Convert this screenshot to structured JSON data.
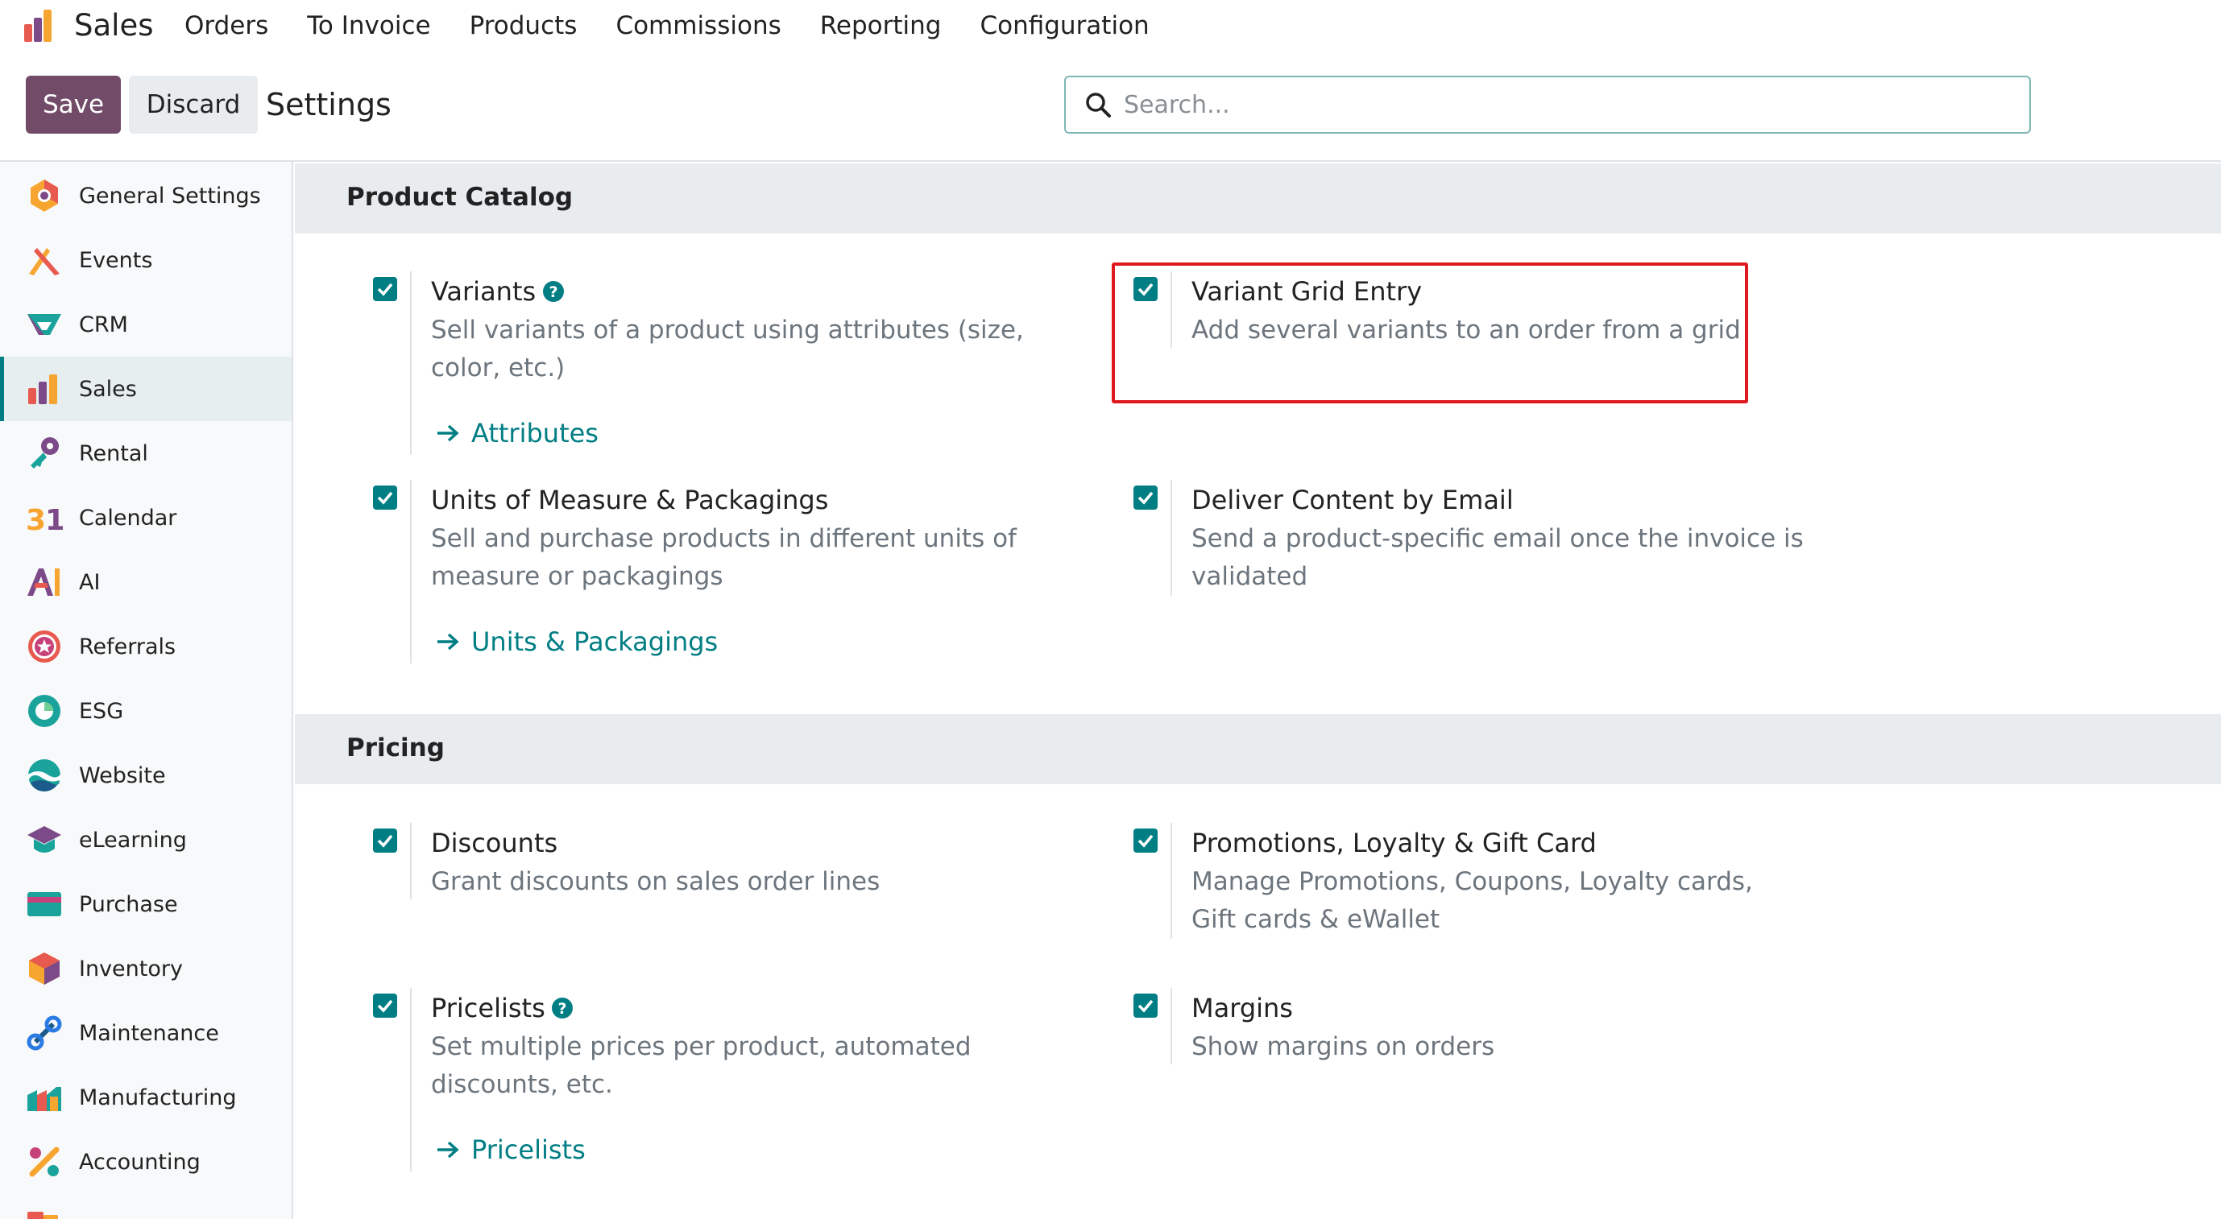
{
  "app": {
    "name": "Sales",
    "menu": [
      "Orders",
      "To Invoice",
      "Products",
      "Commissions",
      "Reporting",
      "Configuration"
    ]
  },
  "controls": {
    "save_label": "Save",
    "discard_label": "Discard",
    "title": "Settings",
    "search_placeholder": "Search..."
  },
  "sidebar": {
    "items": [
      {
        "label": "General Settings",
        "icon": "general-settings-icon"
      },
      {
        "label": "Events",
        "icon": "events-icon"
      },
      {
        "label": "CRM",
        "icon": "crm-icon"
      },
      {
        "label": "Sales",
        "icon": "sales-icon",
        "active": true
      },
      {
        "label": "Rental",
        "icon": "rental-icon"
      },
      {
        "label": "Calendar",
        "icon": "calendar-icon"
      },
      {
        "label": "AI",
        "icon": "ai-icon"
      },
      {
        "label": "Referrals",
        "icon": "referrals-icon"
      },
      {
        "label": "ESG",
        "icon": "esg-icon"
      },
      {
        "label": "Website",
        "icon": "website-icon"
      },
      {
        "label": "eLearning",
        "icon": "elearning-icon"
      },
      {
        "label": "Purchase",
        "icon": "purchase-icon"
      },
      {
        "label": "Inventory",
        "icon": "inventory-icon"
      },
      {
        "label": "Maintenance",
        "icon": "maintenance-icon"
      },
      {
        "label": "Manufacturing",
        "icon": "manufacturing-icon"
      },
      {
        "label": "Accounting",
        "icon": "accounting-icon"
      }
    ]
  },
  "sections": {
    "catalog": {
      "title": "Product Catalog",
      "variants": {
        "title": "Variants",
        "desc": "Sell variants of a product using attributes (size, color, etc.)",
        "link": "Attributes",
        "checked": true
      },
      "grid": {
        "title": "Variant Grid Entry",
        "desc": "Add several variants to an order from a grid",
        "checked": true
      },
      "uom": {
        "title": "Units of Measure & Packagings",
        "desc": "Sell and purchase products in different units of measure or packagings",
        "link": "Units & Packagings",
        "checked": true
      },
      "email": {
        "title": "Deliver Content by Email",
        "desc": "Send a product-specific email once the invoice is validated",
        "checked": true
      }
    },
    "pricing": {
      "title": "Pricing",
      "discounts": {
        "title": "Discounts",
        "desc": "Grant discounts on sales order lines",
        "checked": true
      },
      "promotions": {
        "title": "Promotions, Loyalty & Gift Card",
        "desc": "Manage Promotions, Coupons, Loyalty cards, Gift cards & eWallet",
        "checked": true
      },
      "pricelists": {
        "title": "Pricelists",
        "desc": "Set multiple prices per product, automated discounts, etc.",
        "link": "Pricelists",
        "checked": true
      },
      "margins": {
        "title": "Margins",
        "desc": "Show margins on orders",
        "checked": true
      }
    }
  },
  "colors": {
    "brand": "#714b67",
    "accent": "#017e84",
    "highlight": "#e0191f"
  }
}
